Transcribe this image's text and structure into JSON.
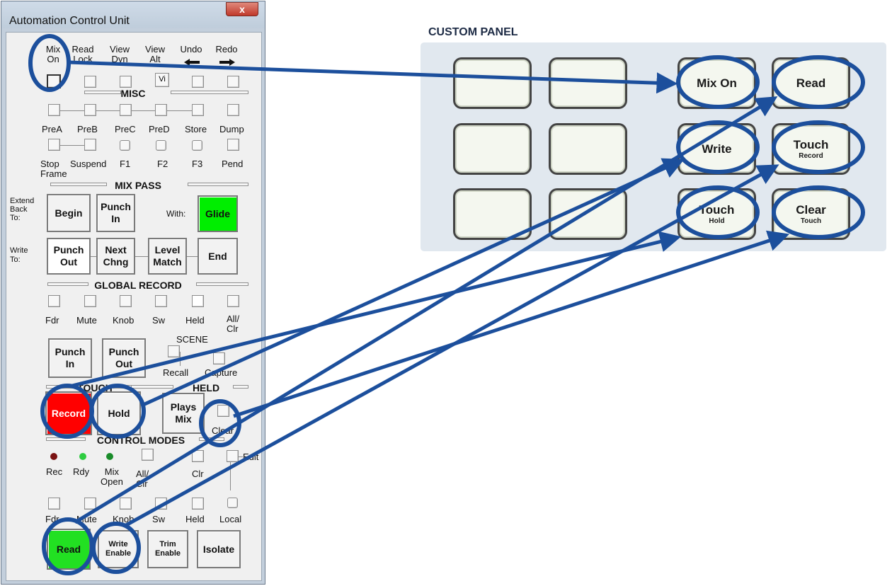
{
  "window": {
    "title": "Automation Control Unit",
    "close_glyph": "x"
  },
  "top_buttons": [
    {
      "label": "Mix\nOn"
    },
    {
      "label": "Read\nLock"
    },
    {
      "label": "View\nDyn"
    },
    {
      "label": "View\nAlt",
      "icon_text": "Vi"
    },
    {
      "label": "Undo",
      "arrow": "left-arrow"
    },
    {
      "label": "Redo",
      "arrow": "right-arrow"
    }
  ],
  "misc": {
    "title": "MISC",
    "row1": [
      "PreA",
      "PreB",
      "PreC",
      "PreD",
      "Store",
      "Dump"
    ],
    "row2": [
      "Stop\nFrame",
      "Suspend",
      "F1",
      "F2",
      "F3",
      "Pend"
    ]
  },
  "mix_pass": {
    "title": "MIX PASS",
    "extend_label": "Extend\nBack\nTo:",
    "write_label": "Write\nTo:",
    "with_label": "With:",
    "begin": "Begin",
    "punch_in": "Punch\nIn",
    "glide": "Glide",
    "punch_out": "Punch\nOut",
    "next_chng": "Next\nChng",
    "level_match": "Level\nMatch",
    "end": "End"
  },
  "global_record": {
    "title": "GLOBAL RECORD",
    "items": [
      "Fdr",
      "Mute",
      "Knob",
      "Sw",
      "Held",
      "All/\nClr"
    ],
    "punch_in": "Punch\nIn",
    "punch_out": "Punch\nOut",
    "scene": "SCENE",
    "recall": "Recall",
    "capture": "Capture"
  },
  "touch_held": {
    "touch_title": "TOUCH",
    "held_title": "HELD",
    "record": "Record",
    "hold": "Hold",
    "plays_mix": "Plays\nMix",
    "clear": "Clear"
  },
  "control_modes": {
    "title": "CONTROL MODES",
    "leds": [
      {
        "label": "Rec",
        "color": "#7a1212"
      },
      {
        "label": "Rdy",
        "color": "#2ecc40"
      },
      {
        "label": "Mix\nOpen",
        "color": "#1a8c2a"
      }
    ],
    "all_clr": "All/\nClr",
    "clr": "Clr",
    "edit": "Edit",
    "items": [
      "Fdr",
      "Mute",
      "Knob",
      "Sw",
      "Held",
      "Local"
    ],
    "read": "Read",
    "write_enable": "Write\nEnable",
    "trim_enable": "Trim\nEnable",
    "isolate": "Isolate"
  },
  "custom_panel": {
    "title": "CUSTOM PANEL",
    "buttons": [
      {
        "main": "",
        "sub": ""
      },
      {
        "main": "",
        "sub": ""
      },
      {
        "main": "Mix On",
        "sub": ""
      },
      {
        "main": "Read",
        "sub": ""
      },
      {
        "main": "",
        "sub": ""
      },
      {
        "main": "",
        "sub": ""
      },
      {
        "main": "Write",
        "sub": ""
      },
      {
        "main": "Touch",
        "sub": "Record"
      },
      {
        "main": "",
        "sub": ""
      },
      {
        "main": "",
        "sub": ""
      },
      {
        "main": "Touch",
        "sub": "Hold"
      },
      {
        "main": "Clear",
        "sub": "Touch"
      }
    ]
  },
  "colors": {
    "record_button": "#ff0000",
    "glide_button": "#00ee00",
    "read_button": "#22e022",
    "highlight_stroke": "#1c4f9c",
    "panel_background": "#e1e8ef"
  }
}
